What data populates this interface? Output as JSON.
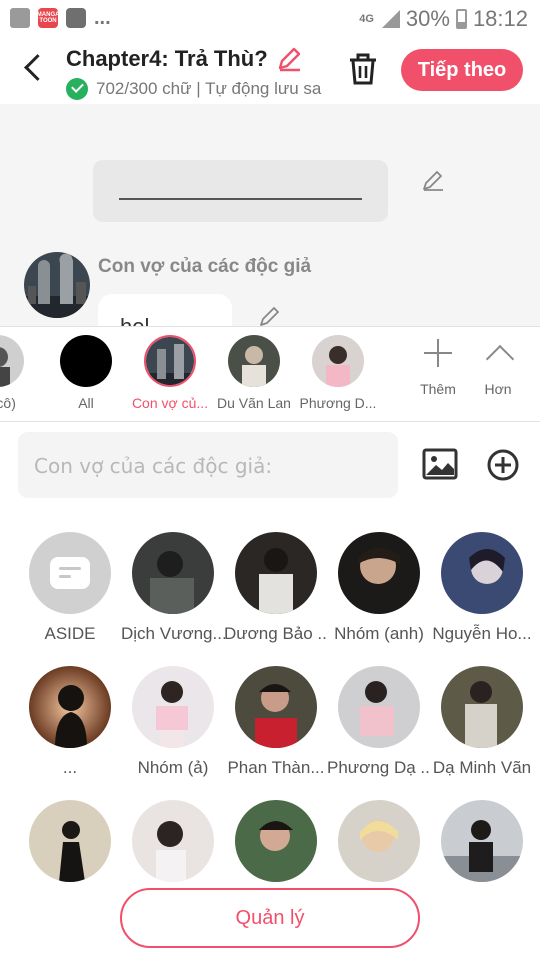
{
  "status_bar": {
    "icons": [
      "gallery-icon",
      "manga-toon-icon",
      "play-icon"
    ],
    "manga_icon_text": "MANGA TOON",
    "overflow": "...",
    "network": "4G",
    "battery": "30%",
    "time": "18:12"
  },
  "header": {
    "title": "Chapter4: Trả Thù?",
    "subtitle": "702/300 chữ | Tự động lưu sa",
    "next_label": "Tiếp theo"
  },
  "editor": {
    "speaker_name": "Con vợ của các độc giả",
    "message_text": "hel..."
  },
  "strip": {
    "items": [
      {
        "label": "n (cô)",
        "avatar": "photo"
      },
      {
        "label": "All",
        "avatar": "black"
      },
      {
        "label": "Con vợ củ...",
        "avatar": "city",
        "selected": true
      },
      {
        "label": "Du Vãn Lan",
        "avatar": "photo"
      },
      {
        "label": "Phương D...",
        "avatar": "photo"
      }
    ],
    "add_label": "Thêm",
    "more_label": "Hơn"
  },
  "input": {
    "placeholder": "Con vợ của các độc giả:"
  },
  "grid": {
    "rows": [
      [
        {
          "label": "ASIDE",
          "type": "aside"
        },
        {
          "label": "Dịch Vương..."
        },
        {
          "label": "Dương Bảo ..."
        },
        {
          "label": "Nhóm (anh)"
        },
        {
          "label": "Nguyễn Ho..."
        }
      ],
      [
        {
          "label": "..."
        },
        {
          "label": "Nhóm (ả)"
        },
        {
          "label": "Phan Thàn..."
        },
        {
          "label": "Phương Dạ ..."
        },
        {
          "label": "Dạ Minh Vãn"
        }
      ],
      [
        {
          "label": ""
        },
        {
          "label": ""
        },
        {
          "label": ""
        },
        {
          "label": ""
        },
        {
          "label": ""
        }
      ]
    ]
  },
  "manage_label": "Quản lý",
  "colors": {
    "accent": "#f1506b",
    "success": "#27b15d",
    "editor_bg": "#f5f5f5"
  }
}
